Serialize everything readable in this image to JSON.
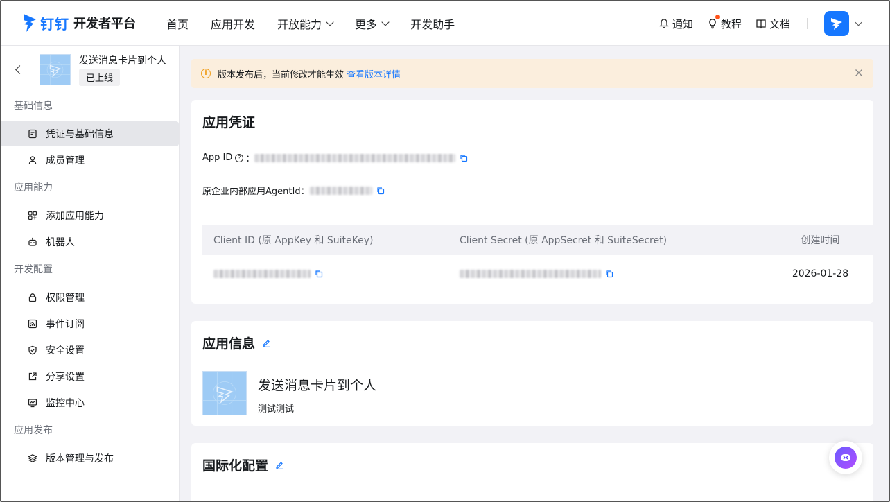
{
  "header": {
    "brand": "钉钉",
    "title": "开发者平台",
    "nav": [
      "首页",
      "应用开发",
      "开放能力",
      "更多",
      "开发助手"
    ],
    "notify": "通知",
    "tutorial": "教程",
    "docs": "文档"
  },
  "sidebar": {
    "app_name": "发送消息卡片到个人",
    "app_status": "已上线",
    "groups": [
      {
        "label": "基础信息",
        "items": [
          {
            "label": "凭证与基础信息",
            "icon": "doc-icon",
            "active": true
          },
          {
            "label": "成员管理",
            "icon": "user-icon"
          }
        ]
      },
      {
        "label": "应用能力",
        "items": [
          {
            "label": "添加应用能力",
            "icon": "apps-icon"
          },
          {
            "label": "机器人",
            "icon": "robot-icon"
          }
        ]
      },
      {
        "label": "开发配置",
        "items": [
          {
            "label": "权限管理",
            "icon": "lock-icon"
          },
          {
            "label": "事件订阅",
            "icon": "rss-icon"
          },
          {
            "label": "安全设置",
            "icon": "shield-icon"
          },
          {
            "label": "分享设置",
            "icon": "share-icon"
          },
          {
            "label": "监控中心",
            "icon": "monitor-icon"
          }
        ]
      },
      {
        "label": "应用发布",
        "items": [
          {
            "label": "版本管理与发布",
            "icon": "layers-icon"
          }
        ]
      }
    ]
  },
  "notice": {
    "text": "版本发布后，当前修改才能生效",
    "link": "查看版本详情"
  },
  "credentials": {
    "title": "应用凭证",
    "app_id_label": "App ID",
    "agent_label": "原企业内部应用AgentId",
    "table": {
      "headers": [
        "Client ID (原 AppKey 和 SuiteKey)",
        "Client Secret (原 AppSecret 和 SuiteSecret)",
        "创建时间"
      ],
      "rows": [
        {
          "created": "2026-01-28"
        }
      ]
    }
  },
  "app_info": {
    "title": "应用信息",
    "name": "发送消息卡片到个人",
    "desc": "测试测试"
  },
  "i18n": {
    "title": "国际化配置"
  },
  "colors": {
    "accent": "#1677ff",
    "notice_bg": "#fbeedd",
    "warn": "#f0a020",
    "dot": "#ff5219"
  }
}
